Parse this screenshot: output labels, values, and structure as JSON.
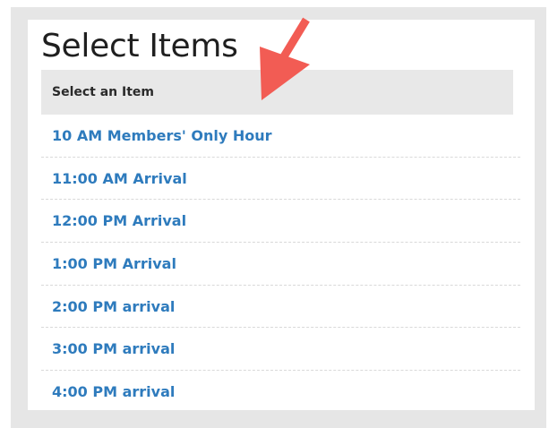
{
  "page": {
    "title": "Select Items",
    "list_header": "Select an Item"
  },
  "items": [
    "10 AM Members' Only Hour",
    "11:00 AM Arrival",
    "12:00 PM Arrival",
    "1:00 PM Arrival",
    "2:00 PM arrival",
    "3:00 PM arrival",
    "4:00 PM arrival"
  ],
  "annotation": {
    "icon": "arrow-pointer-icon",
    "color": "#f25c54"
  },
  "colors": {
    "link": "#2e7bbd",
    "header_bg": "#e8e8e8",
    "frame_bg": "#e6e6e6"
  }
}
